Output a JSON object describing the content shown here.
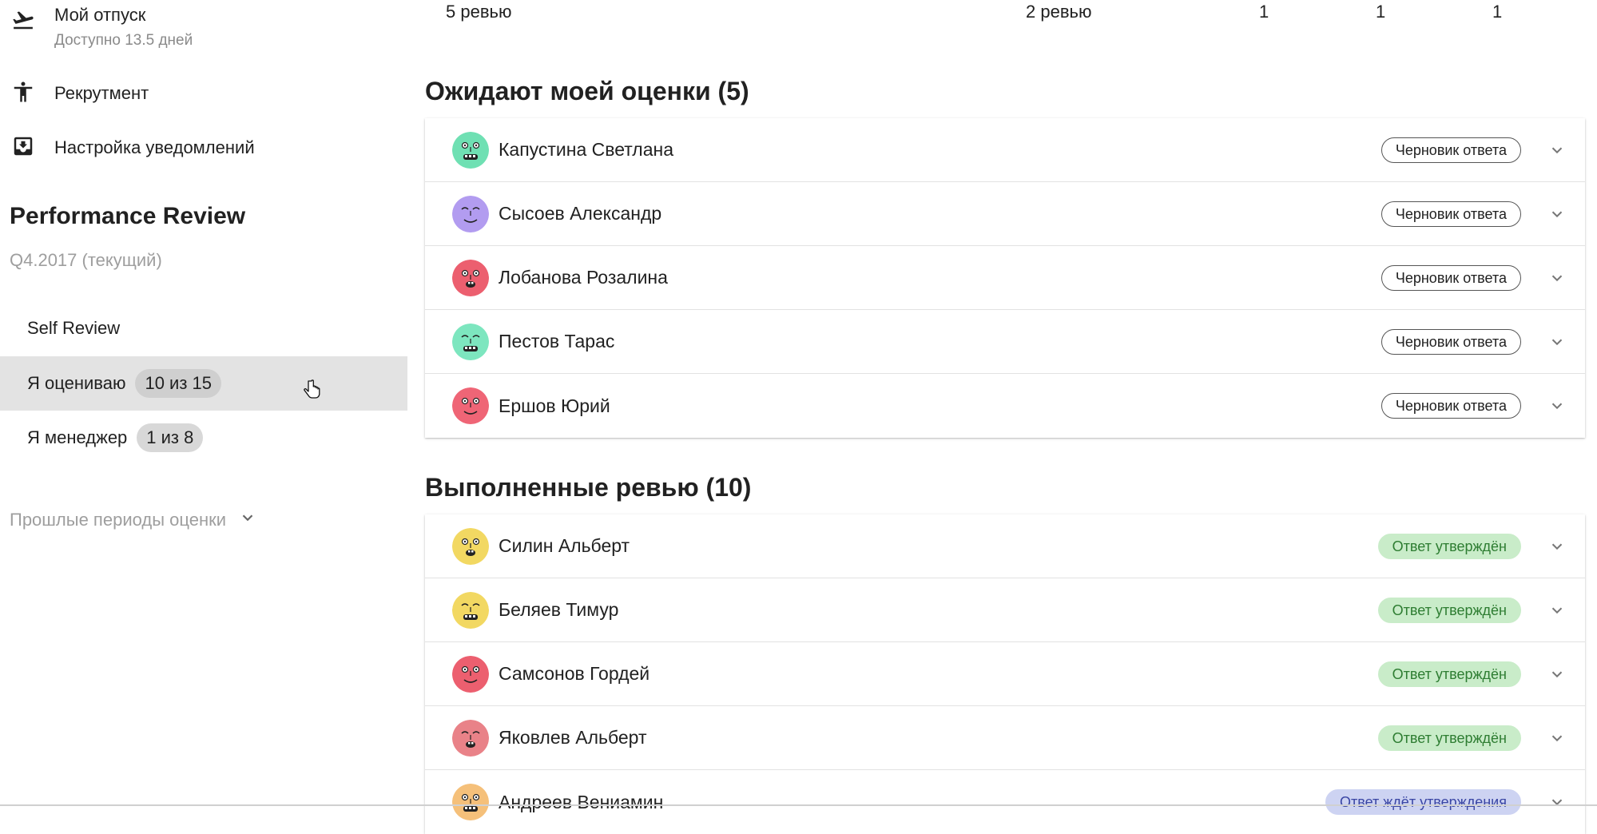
{
  "sidebar": {
    "vacation": {
      "label": "Мой отпуск",
      "sub": "Доступно 13.5 дней",
      "icon": "airplane-departure-icon"
    },
    "recruitment": {
      "label": "Рекрутмент",
      "icon": "person-standing-icon"
    },
    "notifications": {
      "label": "Настройка уведомлений",
      "icon": "inbox-download-icon"
    },
    "performance": {
      "title": "Performance Review",
      "period": "Q4.2017 (текущий)",
      "items": [
        {
          "label": "Self Review",
          "badge": ""
        },
        {
          "label": "Я оцениваю",
          "badge": "10 из 15",
          "active": true
        },
        {
          "label": "Я менеджер",
          "badge": "1 из 8"
        }
      ],
      "past_periods": "Прошлые периоды оценки"
    }
  },
  "summary_row": {
    "col1": "5 ревью",
    "col2": "2 ревью",
    "col3": "1",
    "col4": "1",
    "col5": "1"
  },
  "awaiting": {
    "title": "Ожидают моей оценки (5)",
    "rows": [
      {
        "name": "Капустина Светлана",
        "status": "Черновик ответа",
        "avatar_color": "#6fe0b3"
      },
      {
        "name": "Сысоев Александр",
        "status": "Черновик ответа",
        "avatar_color": "#b29cf0"
      },
      {
        "name": "Лобанова Розалина",
        "status": "Черновик ответа",
        "avatar_color": "#ec5f6f"
      },
      {
        "name": "Пестов Тарас",
        "status": "Черновик ответа",
        "avatar_color": "#7de6bf"
      },
      {
        "name": "Ершов Юрий",
        "status": "Черновик ответа",
        "avatar_color": "#ef6576"
      }
    ]
  },
  "completed": {
    "title": "Выполненные ревью (10)",
    "rows": [
      {
        "name": "Силин Альберт",
        "status": "Ответ утверждён",
        "avatar_color": "#f2d862"
      },
      {
        "name": "Беляев Тимур",
        "status": "Ответ утверждён",
        "avatar_color": "#f2d862"
      },
      {
        "name": "Самсонов Гордей",
        "status": "Ответ утверждён",
        "avatar_color": "#ec5f6f"
      },
      {
        "name": "Яковлев Альберт",
        "status": "Ответ утверждён",
        "avatar_color": "#e98288"
      },
      {
        "name": "Андреев Вениамин",
        "status": "Ответ ждёт утверждения",
        "avatar_color": "#f5c07a"
      }
    ]
  },
  "colors": {
    "approved_bg": "#c9ecc9",
    "approved_text": "#2e7d32",
    "pending_bg": "#cdd3f2",
    "pending_text": "#3a46a4",
    "active_bg": "#e3e3e3"
  }
}
